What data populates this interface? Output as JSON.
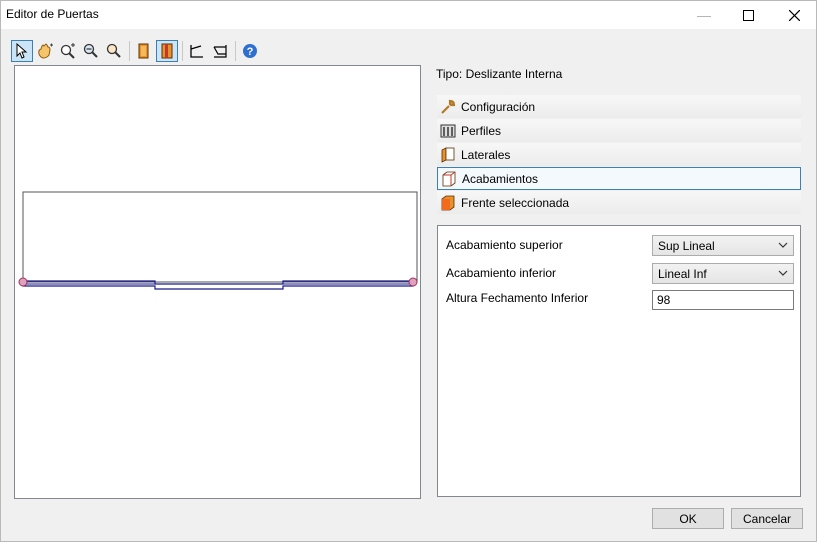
{
  "window": {
    "title": "Editor de Puertas",
    "controls": {
      "minimize": "—",
      "maximize": "☐",
      "close": "✕"
    }
  },
  "toolbar": {
    "buttons": [
      {
        "name": "select-pointer-icon",
        "active": true
      },
      {
        "name": "pan-hand-icon",
        "active": false
      },
      {
        "name": "zoom-in-icon",
        "active": false
      },
      {
        "name": "zoom-out-icon",
        "active": false
      },
      {
        "name": "zoom-extents-icon",
        "active": false
      },
      {
        "name": "door-front-icon",
        "active": false
      },
      {
        "name": "door-side-icon",
        "active": true
      },
      {
        "name": "profile-left-icon",
        "active": false
      },
      {
        "name": "profile-right-icon",
        "active": false
      },
      {
        "name": "help-icon",
        "active": false
      }
    ]
  },
  "panel": {
    "tipo": "Tipo: Deslizante Interna",
    "sections": [
      {
        "label": "Configuración",
        "icon": "wrench-icon",
        "selected": false
      },
      {
        "label": "Perfiles",
        "icon": "profiles-icon",
        "selected": false
      },
      {
        "label": "Laterales",
        "icon": "laterals-icon",
        "selected": false
      },
      {
        "label": "Acabamientos",
        "icon": "finishes-icon",
        "selected": true
      },
      {
        "label": "Frente seleccionada",
        "icon": "front-icon",
        "selected": false
      }
    ]
  },
  "properties": {
    "acab_sup": {
      "label": "Acabamiento superior",
      "value": "Sup Lineal"
    },
    "acab_inf": {
      "label": "Acabamiento inferior",
      "value": "Lineal Inf"
    },
    "altura": {
      "label": "Altura Fechamento Inferior",
      "value": "98"
    }
  },
  "buttons": {
    "ok": "OK",
    "cancel": "Cancelar"
  },
  "colors": {
    "accent": "#3c7fb1",
    "drawing_line": "#1a1a8c",
    "handle": "#cc3366"
  }
}
